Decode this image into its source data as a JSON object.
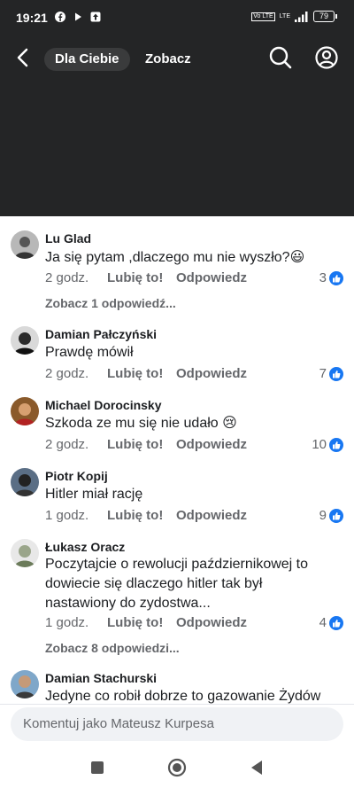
{
  "status_bar": {
    "time": "19:21",
    "battery": "79",
    "network": "LTE",
    "volte": "Vo LTE"
  },
  "header": {
    "tabs": [
      {
        "label": "Dla Ciebie",
        "active": true
      },
      {
        "label": "Zobacz",
        "active": false
      }
    ]
  },
  "comments": [
    {
      "author": "Lu Glad",
      "text": "Ja się pytam ,dlaczego mu nie wyszło?😃",
      "time": "2 godz.",
      "like_label": "Lubię to!",
      "reply_label": "Odpowiedz",
      "likes": "3",
      "see_replies": "Zobacz 1 odpowiedź..."
    },
    {
      "author": "Damian Pałczyński",
      "text": "Prawdę mówił",
      "time": "2 godz.",
      "like_label": "Lubię to!",
      "reply_label": "Odpowiedz",
      "likes": "7"
    },
    {
      "author": "Michael Dorocinsky",
      "text": "Szkoda ze mu się nie udało 😢",
      "time": "2 godz.",
      "like_label": "Lubię to!",
      "reply_label": "Odpowiedz",
      "likes": "10"
    },
    {
      "author": "Piotr Kopij",
      "text": "Hitler miał rację",
      "time": "1 godz.",
      "like_label": "Lubię to!",
      "reply_label": "Odpowiedz",
      "likes": "9"
    },
    {
      "author": "Łukasz Oracz",
      "text": "Poczytajcie o rewolucji październikowej to dowiecie się dlaczego hitler tak był nastawiony do zydostwa...",
      "time": "1 godz.",
      "like_label": "Lubię to!",
      "reply_label": "Odpowiedz",
      "likes": "4",
      "see_replies": "Zobacz 8 odpowiedzi..."
    },
    {
      "author": "Damian Stachurski",
      "text": "Jedyne co robił dobrze to gazowanie Żydów"
    }
  ],
  "composer": {
    "placeholder": "Komentuj jako Mateusz Kurpesa"
  },
  "colors": {
    "header_bg": "#242526",
    "like_blue": "#1877f2",
    "meta_gray": "#65676b"
  }
}
